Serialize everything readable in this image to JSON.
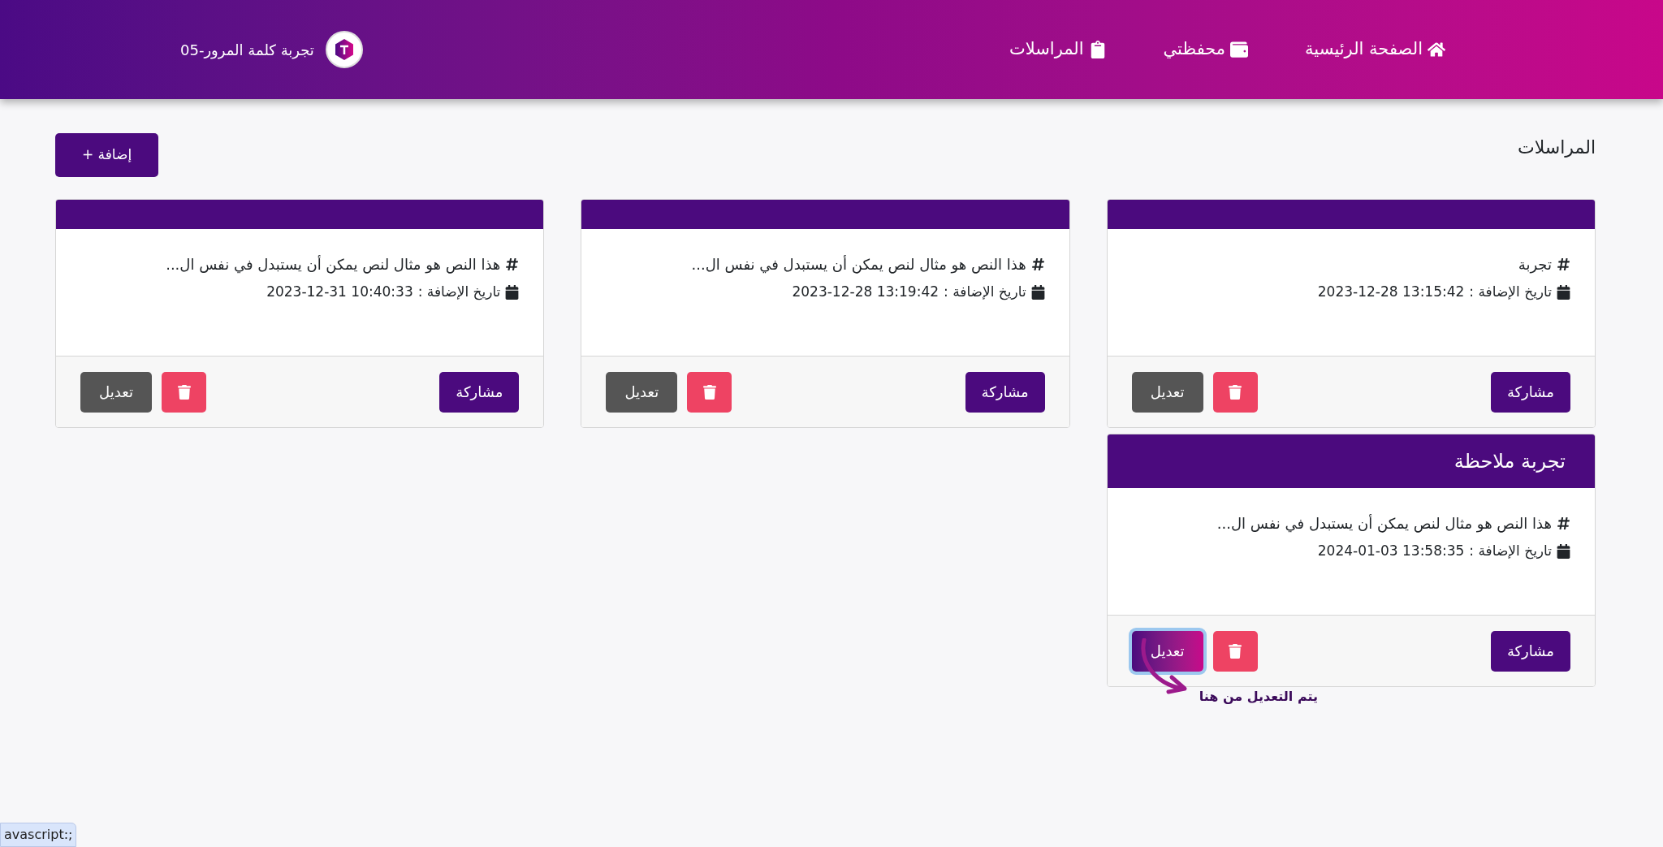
{
  "header": {
    "brand": "تجربة كلمة المرور-05",
    "nav": [
      {
        "label": "الصفحة الرئيسية",
        "kind": "home"
      },
      {
        "label": "محفظتي",
        "kind": "wallet"
      },
      {
        "label": "المراسلات",
        "kind": "clipboard"
      }
    ]
  },
  "page": {
    "title": "المراسلات",
    "add_button": "إضافة +"
  },
  "cards": [
    {
      "text": "تجربة",
      "date_label": "تاريخ الإضافة :",
      "date": "2023-12-28 13:15:42",
      "share": "مشاركة",
      "edit": "تعديل",
      "edit_focused": false
    },
    {
      "text": "هذا النص هو مثال لنص يمكن أن يستبدل في نفس ال...",
      "date_label": "تاريخ الإضافة :",
      "date": "2023-12-28 13:19:42",
      "share": "مشاركة",
      "edit": "تعديل",
      "edit_focused": false
    },
    {
      "text": "هذا النص هو مثال لنص يمكن أن يستبدل في نفس ال...",
      "date_label": "تاريخ الإضافة :",
      "date": "2023-12-31 10:40:33",
      "share": "مشاركة",
      "edit": "تعديل",
      "edit_focused": false
    },
    {
      "title": "تجربة ملاحظة",
      "text": "هذا النص هو مثال لنص يمكن أن يستبدل في نفس ال...",
      "date_label": "تاريخ الإضافة :",
      "date": "2024-01-03 13:58:35",
      "share": "مشاركة",
      "edit": "تعديل",
      "edit_focused": true,
      "annotation": "يتم التعديل من هنا"
    }
  ],
  "status_bar": {
    "link": "avascript:;"
  }
}
